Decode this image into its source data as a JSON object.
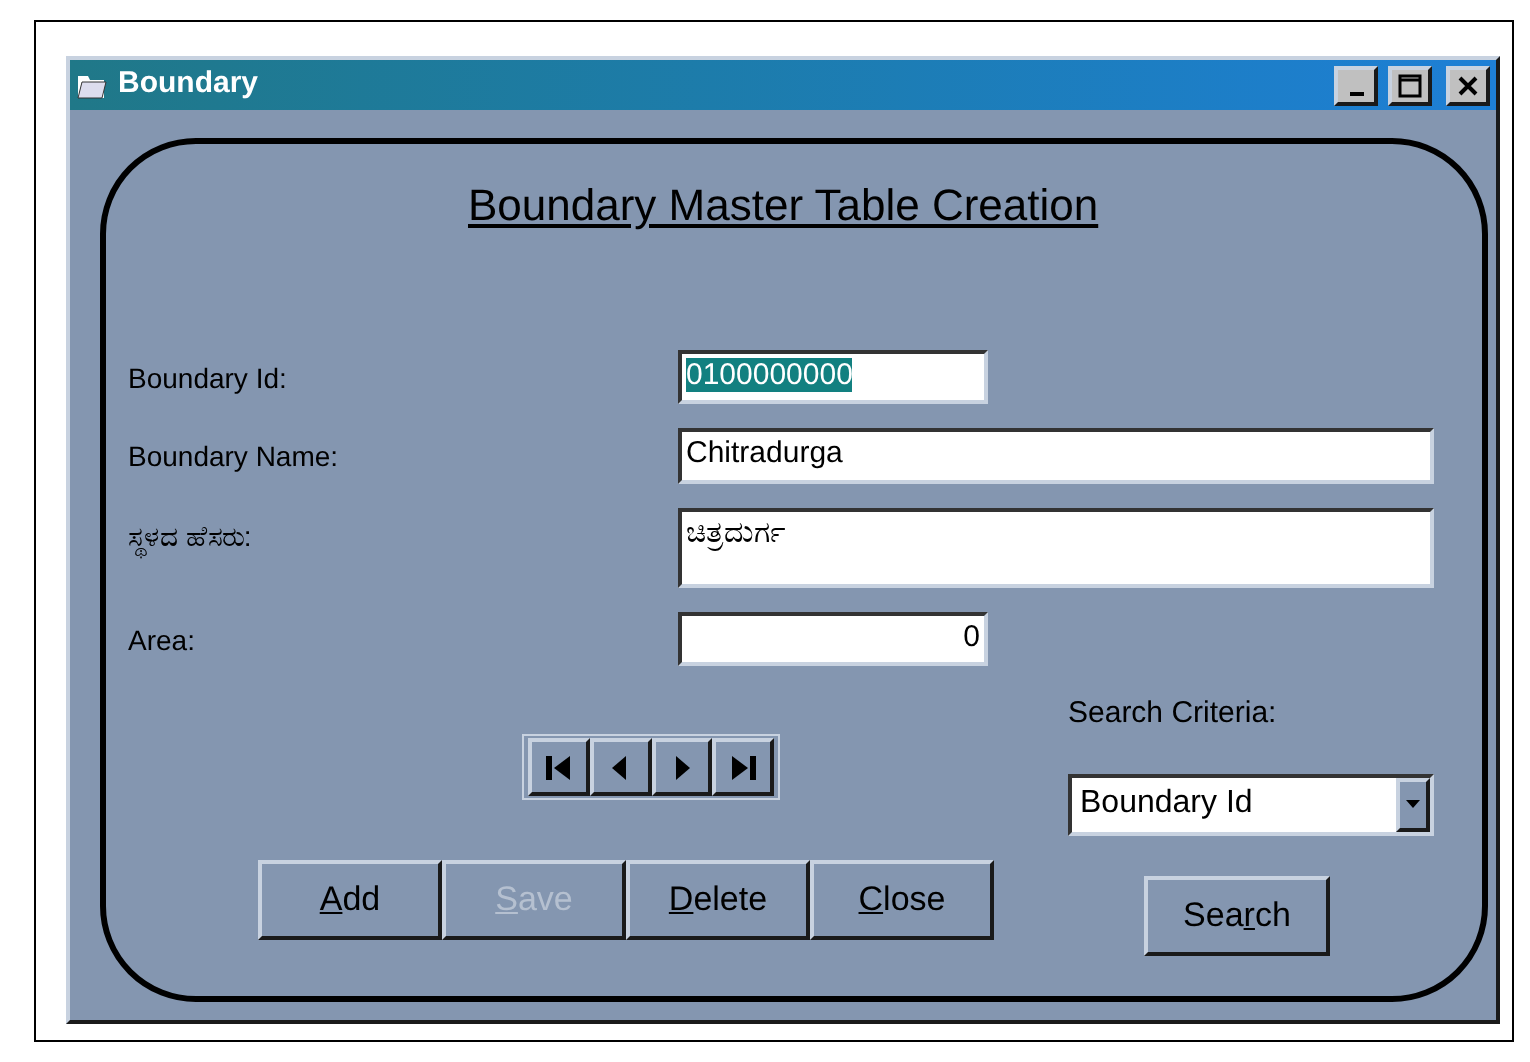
{
  "window": {
    "title": "Boundary"
  },
  "heading": "Boundary Master Table Creation",
  "fields": [
    {
      "label": "Boundary Id:",
      "value": "0100000000",
      "selected": true,
      "kind": "code"
    },
    {
      "label": "Boundary Name:",
      "value": "Chitradurga",
      "selected": false,
      "kind": "text"
    },
    {
      "label": "ಸ್ಥಳದ ಹೆಸರು:",
      "value": "ಚಿತ್ರದುರ್ಗ",
      "selected": false,
      "kind": "multiline"
    },
    {
      "label": "Area:",
      "value": "0",
      "selected": false,
      "kind": "number"
    }
  ],
  "navigator": [
    {
      "kind": "first"
    },
    {
      "kind": "prev"
    },
    {
      "kind": "next"
    },
    {
      "kind": "last"
    }
  ],
  "search_criteria": {
    "label": "Search Criteria:",
    "value": "Boundary Id"
  },
  "buttons": [
    {
      "key": "A",
      "after": "dd",
      "disabled": false
    },
    {
      "key": "S",
      "after": "ave",
      "disabled": true
    },
    {
      "key": "D",
      "after": "elete",
      "disabled": false
    },
    {
      "key": "C",
      "after": "lose",
      "disabled": false
    }
  ],
  "search_button": {
    "before": "Sea",
    "key": "r",
    "after": "ch",
    "disabled": false
  }
}
